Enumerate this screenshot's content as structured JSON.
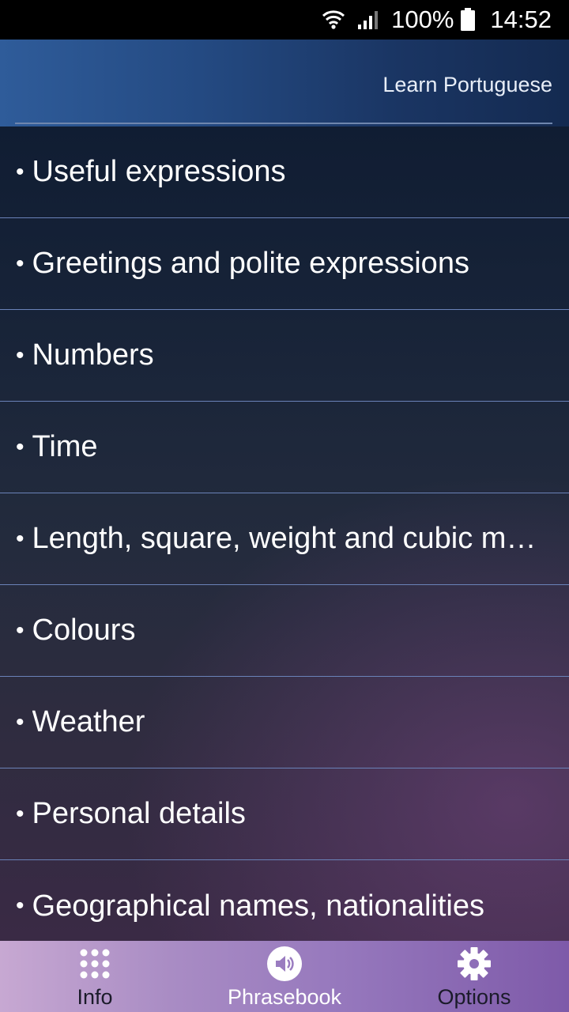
{
  "status_bar": {
    "battery_percent": "100%",
    "time": "14:52"
  },
  "header": {
    "title": "Learn Portuguese"
  },
  "categories": [
    {
      "bullet": "•",
      "label": "Useful expressions"
    },
    {
      "bullet": "•",
      "label": "Greetings and polite expressions"
    },
    {
      "bullet": "•",
      "label": "Numbers"
    },
    {
      "bullet": "•",
      "label": "Time"
    },
    {
      "bullet": "•",
      "label": "Length, square, weight and cubic m…"
    },
    {
      "bullet": "•",
      "label": "Colours"
    },
    {
      "bullet": "•",
      "label": "Weather"
    },
    {
      "bullet": "•",
      "label": "Personal details"
    },
    {
      "bullet": "•",
      "label": "Geographical names, nationalities"
    }
  ],
  "bottom_nav": {
    "info": {
      "label": "Info",
      "icon": "grid-icon"
    },
    "phrasebook": {
      "label": "Phrasebook",
      "icon": "speaker-icon",
      "active": true
    },
    "options": {
      "label": "Options",
      "icon": "gear-icon"
    }
  },
  "colors": {
    "header_blue": "#2f5c9a",
    "divider": "#6a82b8",
    "nav_purple": "#9678bd"
  }
}
